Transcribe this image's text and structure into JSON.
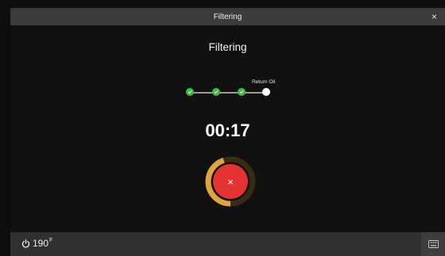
{
  "header": {
    "title": "Filtering",
    "close_glyph": "×"
  },
  "main": {
    "heading": "Filtering",
    "steps": [
      {
        "state": "done",
        "label": ""
      },
      {
        "state": "done",
        "label": ""
      },
      {
        "state": "done",
        "label": ""
      },
      {
        "state": "current",
        "label": "Return Oil"
      }
    ],
    "timer": "00:17",
    "progress_fraction": 0.45,
    "cancel_glyph": "×"
  },
  "footer": {
    "power_icon": "power-icon",
    "temperature": "190",
    "temperature_unit": "F"
  },
  "colors": {
    "accent_green": "#3bbf3b",
    "cancel_red": "#e53232",
    "progress_orange": "#e0a43c",
    "progress_track": "#3a2c14"
  }
}
